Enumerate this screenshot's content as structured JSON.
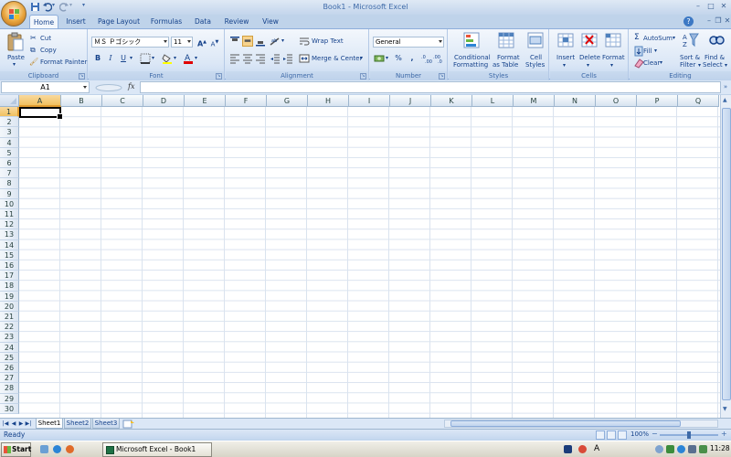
{
  "window": {
    "title": "Book1 - Microsoft Excel",
    "controls": {
      "minimize": "–",
      "maximize": "□",
      "close": "✕"
    }
  },
  "tabs": [
    "Home",
    "Insert",
    "Page Layout",
    "Formulas",
    "Data",
    "Review",
    "View"
  ],
  "ribbon": {
    "clipboard": {
      "paste": "Paste",
      "cut": "Cut",
      "copy": "Copy",
      "format_painter": "Format Painter",
      "label": "Clipboard"
    },
    "font": {
      "name": "ＭＳ Ｐゴシック",
      "size": "11",
      "bold": "B",
      "italic": "I",
      "underline": "U",
      "label": "Font"
    },
    "alignment": {
      "wrap_text": "Wrap Text",
      "merge_center": "Merge & Center",
      "label": "Alignment"
    },
    "number": {
      "format": "General",
      "percent": "%",
      "comma": ",",
      "label": "Number"
    },
    "styles": {
      "conditional_1": "Conditional",
      "conditional_2": "Formatting",
      "format_table_1": "Format",
      "format_table_2": "as Table",
      "cell_styles_1": "Cell",
      "cell_styles_2": "Styles",
      "label": "Styles"
    },
    "cells": {
      "insert": "Insert",
      "delete": "Delete",
      "format": "Format",
      "label": "Cells"
    },
    "editing": {
      "autosum": "AutoSum",
      "fill": "Fill",
      "clear": "Clear",
      "sort_1": "Sort &",
      "sort_2": "Filter",
      "find_1": "Find &",
      "find_2": "Select",
      "label": "Editing"
    }
  },
  "formula_bar": {
    "name_box": "A1",
    "fx": "fx",
    "formula": ""
  },
  "grid": {
    "columns": [
      "A",
      "B",
      "C",
      "D",
      "E",
      "F",
      "G",
      "H",
      "I",
      "J",
      "K",
      "L",
      "M",
      "N",
      "O",
      "P",
      "Q"
    ],
    "rows": [
      "1",
      "2",
      "3",
      "4",
      "5",
      "6",
      "7",
      "8",
      "9",
      "10",
      "11",
      "12",
      "13",
      "14",
      "15",
      "16",
      "17",
      "18",
      "19",
      "20",
      "21",
      "22",
      "23",
      "24",
      "25",
      "26",
      "27",
      "28",
      "29",
      "30"
    ],
    "active_cell": "A1"
  },
  "sheets": [
    "Sheet1",
    "Sheet2",
    "Sheet3"
  ],
  "status": {
    "text": "Ready",
    "zoom": "100%"
  },
  "taskbar": {
    "start": "Start",
    "task_label": "Microsoft Excel - Book1",
    "clock": "11:28"
  },
  "colors": {
    "ribbon": "#dbe7f6",
    "accent": "#15428b",
    "selected_header": "#f1c15f"
  }
}
